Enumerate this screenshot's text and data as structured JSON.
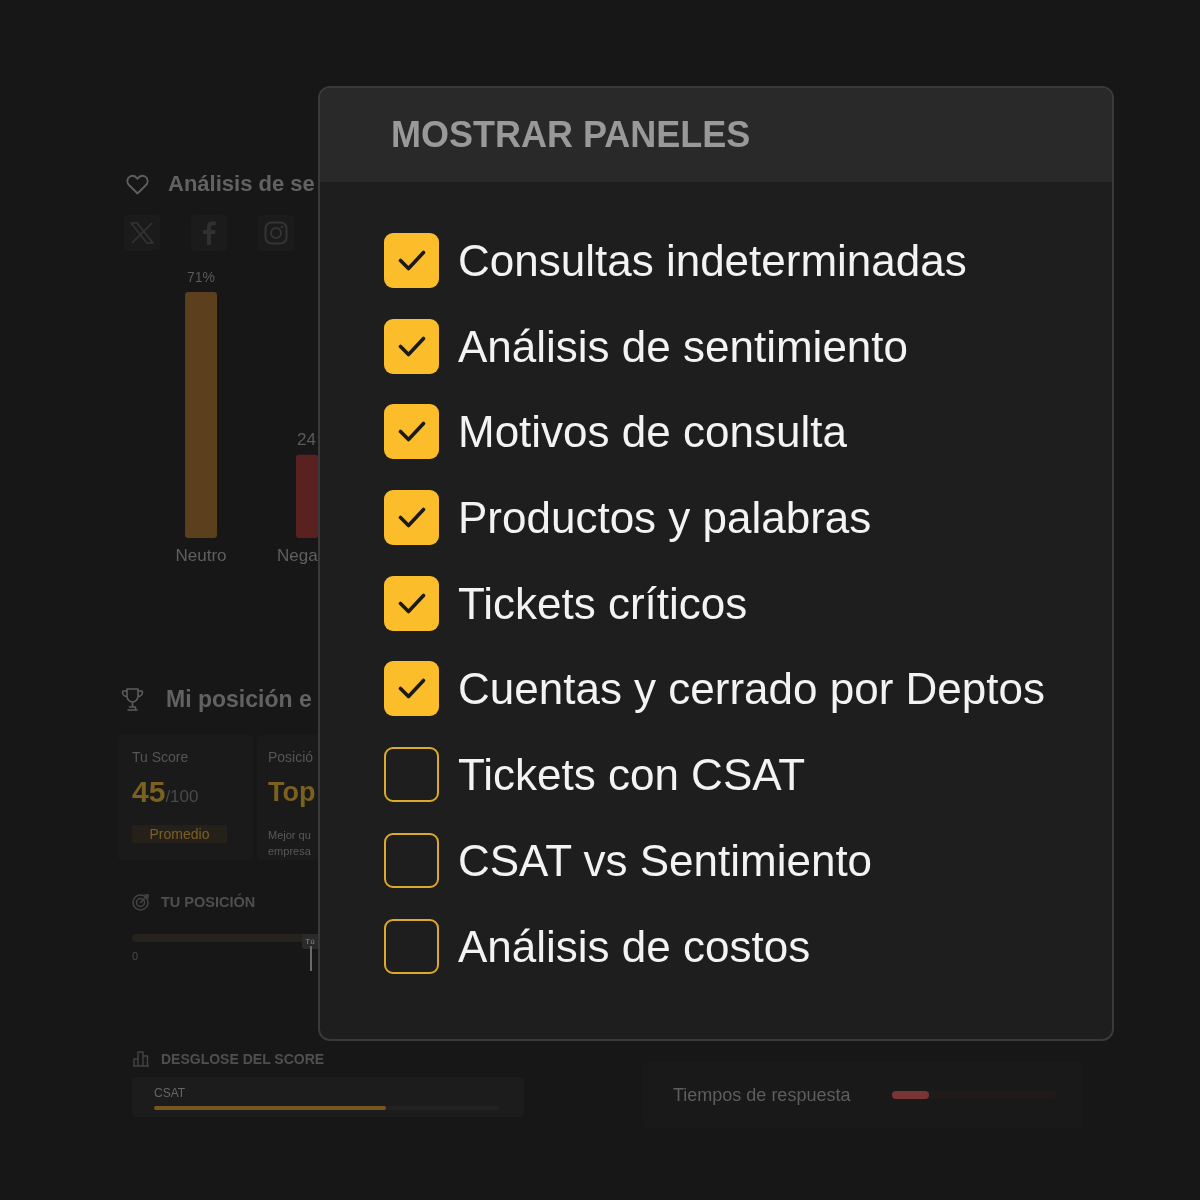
{
  "dashboard": {
    "sentiment_panel": {
      "title": "Análisis de se",
      "chart_data": {
        "type": "bar",
        "categories": [
          "Neutro",
          "Nega"
        ],
        "values": [
          71,
          24
        ],
        "colors": [
          "#5c3f1c",
          "#5a2121"
        ],
        "value_labels": [
          "71%",
          "24"
        ]
      }
    },
    "position_panel": {
      "title": "Mi posición e",
      "score_card": {
        "label": "Tu Score",
        "value": "45",
        "suffix": "/100",
        "badge": "Promedio"
      },
      "rank_card": {
        "label": "Posició",
        "value": "Top",
        "note_lines": [
          "Mejor qu",
          "empresa"
        ]
      },
      "position": {
        "title": "TU POSICIÓN",
        "marker": "Tú",
        "axis_min": "0"
      }
    },
    "breakdown": {
      "title": "DESGLOSE DEL SCORE",
      "items": [
        {
          "label": "CSAT",
          "level": 0.67
        }
      ]
    },
    "metrics": [
      {
        "label": "Tiempos de respuesta",
        "level": 0.22
      }
    ]
  },
  "dialog": {
    "title": "MOSTRAR PANELES",
    "options": [
      {
        "label": "Consultas indeterminadas",
        "checked": true
      },
      {
        "label": "Análisis de sentimiento",
        "checked": true
      },
      {
        "label": "Motivos de consulta",
        "checked": true
      },
      {
        "label": "Productos y palabras",
        "checked": true
      },
      {
        "label": "Tickets críticos",
        "checked": true
      },
      {
        "label": "Cuentas y cerrado por Deptos",
        "checked": true
      },
      {
        "label": "Tickets con CSAT",
        "checked": false
      },
      {
        "label": "CSAT vs Sentimiento",
        "checked": false
      },
      {
        "label": "Análisis de costos",
        "checked": false
      }
    ]
  }
}
